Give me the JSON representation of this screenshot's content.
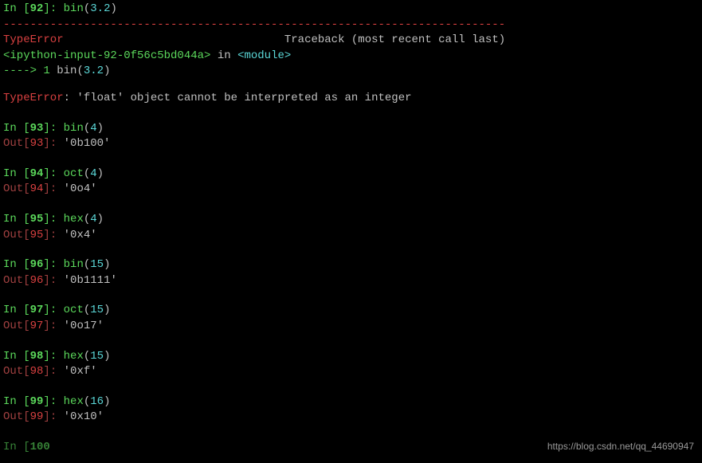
{
  "cells": [
    {
      "in_num": "92",
      "in_func": "bin",
      "in_arg": "3.2",
      "has_error": true,
      "error": {
        "type": "TypeError",
        "traceback_label": "Traceback (most recent call last)",
        "ipython_ref": "<ipython-input-92-0f56c5bd044a>",
        "in_word": " in ",
        "module": "<module>",
        "arrow": "----> 1 ",
        "arrow_func": "bin",
        "arrow_arg": "3.2",
        "message": ": 'float' object cannot be interpreted as an integer"
      }
    },
    {
      "in_num": "93",
      "in_func": "bin",
      "in_arg": "4",
      "out_num": "93",
      "out_val": " '0b100'"
    },
    {
      "in_num": "94",
      "in_func": "oct",
      "in_arg": "4",
      "out_num": "94",
      "out_val": " '0o4'"
    },
    {
      "in_num": "95",
      "in_func": "hex",
      "in_arg": "4",
      "out_num": "95",
      "out_val": " '0x4'"
    },
    {
      "in_num": "96",
      "in_func": "bin",
      "in_arg": "15",
      "out_num": "96",
      "out_val": " '0b1111'"
    },
    {
      "in_num": "97",
      "in_func": "oct",
      "in_arg": "15",
      "out_num": "97",
      "out_val": " '0o17'"
    },
    {
      "in_num": "98",
      "in_func": "hex",
      "in_arg": "15",
      "out_num": "98",
      "out_val": " '0xf'"
    },
    {
      "in_num": "99",
      "in_func": "hex",
      "in_arg": "16",
      "out_num": "99",
      "out_val": " '0x10'"
    }
  ],
  "labels": {
    "in_prefix": "In [",
    "in_suffix": "]: ",
    "out_prefix": "Out[",
    "out_suffix": "]:",
    "lparen": "(",
    "rparen": ")",
    "sep": "---------------------------------------------------------------------------",
    "sp33": "                                 ",
    "next_partial": "100"
  },
  "watermark": "https://blog.csdn.net/qq_44690947"
}
